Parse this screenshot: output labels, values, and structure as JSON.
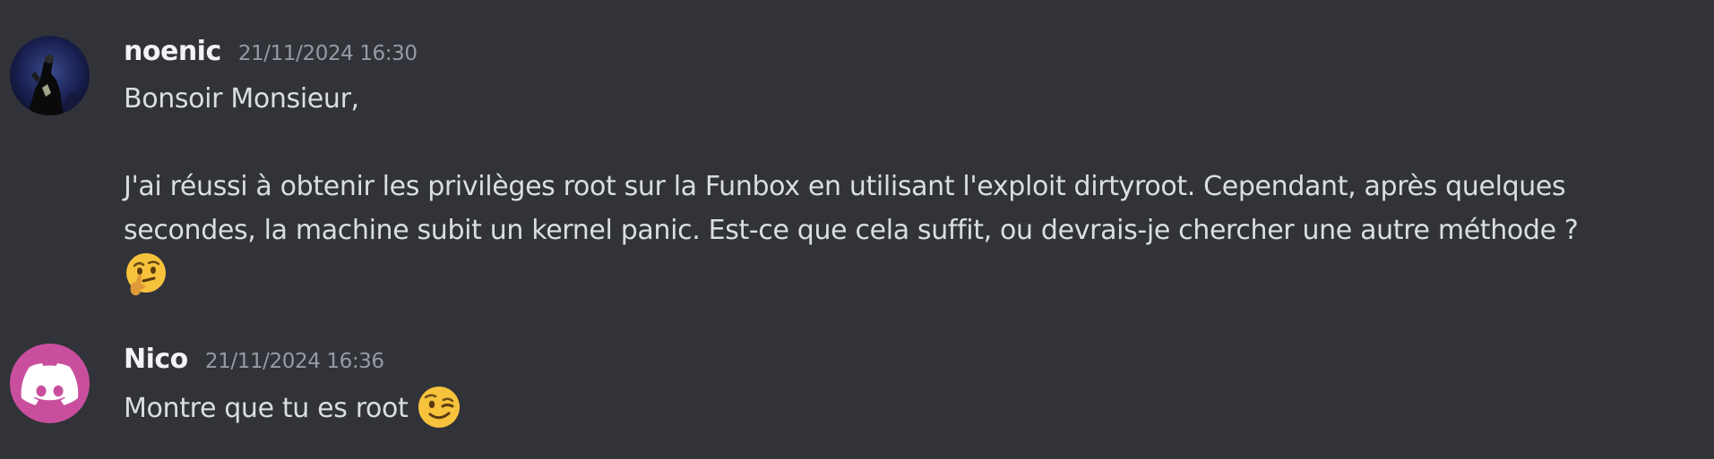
{
  "messages": [
    {
      "author": "noenic",
      "timestamp": "21/11/2024 16:30",
      "greeting": "Bonsoir Monsieur,",
      "body_line1": "J'ai réussi à obtenir les privilèges root sur la Funbox en utilisant l'exploit dirtyroot. Cependant, après quelques",
      "body_line2": "secondes, la machine subit un kernel panic. Est-ce que cela suffit, ou devrais-je chercher une autre méthode ?",
      "emoji": "thinking-face-emoji"
    },
    {
      "author": "Nico",
      "timestamp": "21/11/2024 16:36",
      "text": "Montre que tu es root",
      "emoji": "winking-face-emoji",
      "avatar_color": "#c94f9e"
    }
  ],
  "colors": {
    "background": "#313338",
    "username": "#f2f3f5",
    "timestamp": "#949ba4",
    "text": "#dbdee1"
  }
}
